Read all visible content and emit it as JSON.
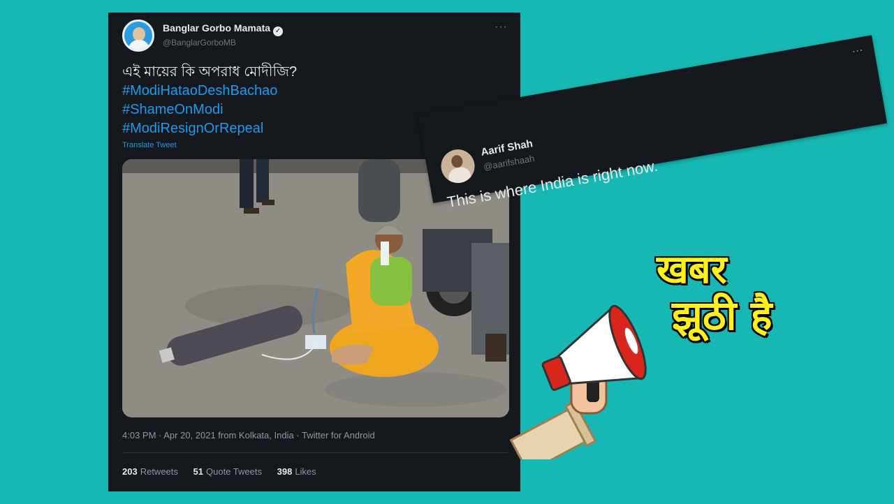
{
  "tweet": {
    "display_name": "Banglar Gorbo Mamata",
    "verified_mark": "✓",
    "handle": "@BanglarGorboMB",
    "more": "···",
    "text_line": "এই মায়ের কি অপরাধ মোদীজি?",
    "hashtags": [
      "#ModiHataoDeshBachao",
      "#ShameOnModi",
      "#ModiResignOrRepeal"
    ],
    "translate_label": "Translate Tweet",
    "meta": "4:03 PM · Apr 20, 2021 from Kolkata, India · Twitter for Android",
    "stats": {
      "retweets_count": "203",
      "retweets_label": "Retweets",
      "quotes_count": "51",
      "quotes_label": "Quote Tweets",
      "likes_count": "398",
      "likes_label": "Likes"
    }
  },
  "tweet2": {
    "display_name": "Aarif Shah",
    "handle": "@aarifshaah",
    "text": "This is where India is right now.",
    "more": "···"
  },
  "headline": {
    "line1": "खबर",
    "line2": "झूठी है"
  },
  "colors": {
    "background": "#17b8b3",
    "card": "#15181c",
    "hashtag": "#1d9bf0",
    "headline": "#ffef1a",
    "megaphone_red": "#d9261c"
  },
  "icons": [
    "verified-icon",
    "more-icon",
    "megaphone-icon"
  ]
}
